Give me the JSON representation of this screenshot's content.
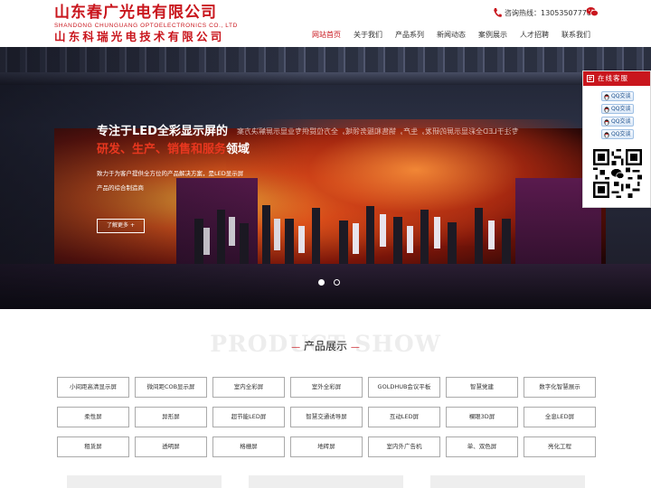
{
  "header": {
    "logo_cn": "山东春广光电有限公司",
    "logo_en": "SHANDONG CHUNGUANG OPTOELECTRONICS CO., LTD",
    "logo_cn2": "山东科瑞光电技术有限公司",
    "hotline": "咨询热线：13053507778",
    "nav": [
      "网站首页",
      "关于我们",
      "产品系列",
      "新闻动态",
      "案例展示",
      "人才招聘",
      "联系我们"
    ],
    "active_nav": "网站首页"
  },
  "banner": {
    "title_line1": "专注于LED全彩显示屏的",
    "title_line2_hl": "研发、生产、销售和服务",
    "title_line2_plain": "领域",
    "mirror_text": "专注于LED全彩显示屏的研发，生产，销售和服务领域，全方位提供专业显示屏解决方案",
    "desc": "致力于为客户提供全方位的产品解决方案，是LED显示屏产品的综合制造商",
    "button": "了解更多 +",
    "slides": 2,
    "active_slide": 0
  },
  "online_service": {
    "title": "在线客服",
    "qq_buttons": [
      "QQ交谈",
      "QQ交谈",
      "QQ交谈",
      "QQ交谈"
    ]
  },
  "products": {
    "bg_title": "PRODUCT SHOW",
    "title": "产品展示",
    "items": [
      "小间距高清显示屏",
      "微间距COB显示屏",
      "室内全彩屏",
      "室外全彩屏",
      "GOLDHUB会议平板",
      "智慧党建",
      "数字化智慧展示",
      "柔性屏",
      "异形屏",
      "超节能LED屏",
      "智慧交通诱导屏",
      "互动LED屏",
      "裸眼3D屏",
      "全息LED屏",
      "租赁屏",
      "透明屏",
      "格栅屏",
      "地砖屏",
      "室内外广告机",
      "单、双色屏",
      "亮化工程"
    ]
  },
  "colors": {
    "brand": "#c9161d",
    "qq_border": "#9fc0e4"
  }
}
